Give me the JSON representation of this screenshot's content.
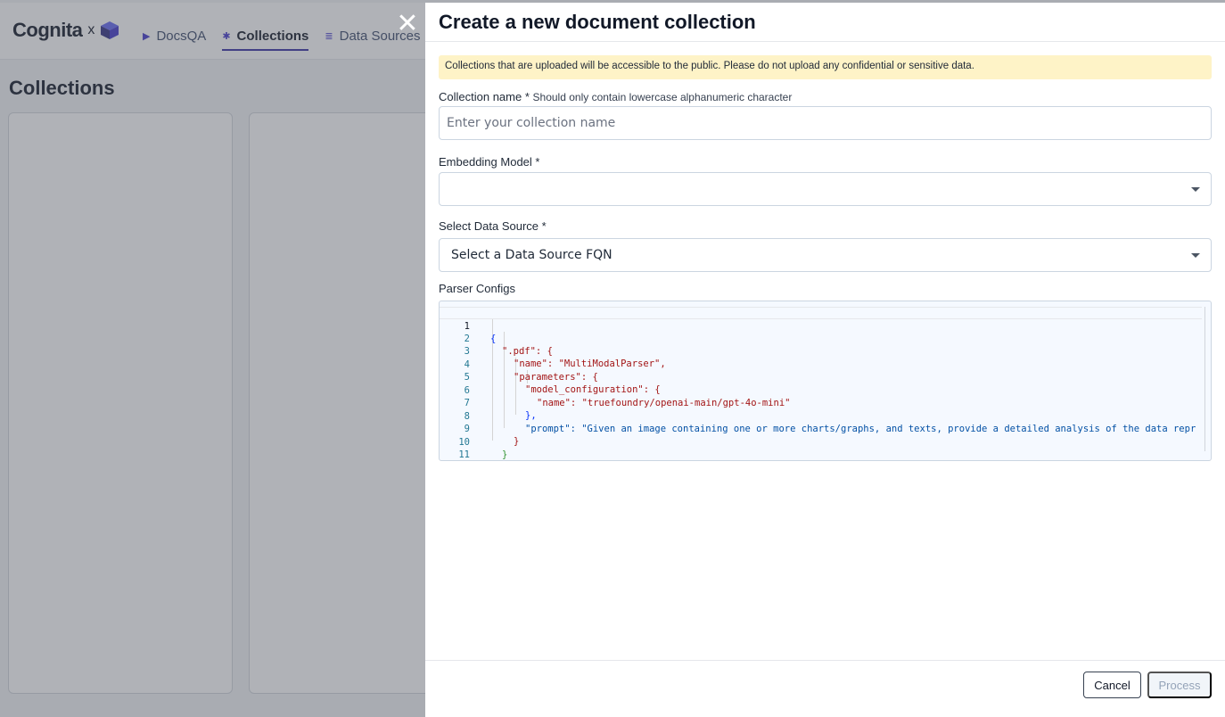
{
  "app": {
    "logo_text": "Cognita",
    "logo_x": "x",
    "nav": [
      {
        "label": "DocsQA",
        "icon": "play-icon"
      },
      {
        "label": "Collections",
        "icon": "gear-icon"
      },
      {
        "label": "Data Sources",
        "icon": "database-icon"
      }
    ],
    "page_title": "Collections"
  },
  "drawer": {
    "title": "Create a new document collection",
    "notice": "Collections that are uploaded will be accessible to the public. Please do not upload any confidential or sensitive data.",
    "collection_name": {
      "label": "Collection name *",
      "hint": "Should only contain lowercase alphanumeric character",
      "placeholder": "Enter your collection name",
      "value": ""
    },
    "embedding_model": {
      "label": "Embedding Model *",
      "value": ""
    },
    "data_source": {
      "label": "Select Data Source *",
      "value": "Select a Data Source FQN"
    },
    "parser_configs": {
      "label": "Parser Configs",
      "line_numbers": [
        "1",
        "2",
        "3",
        "4",
        "5",
        "6",
        "7",
        "8",
        "9",
        "10",
        "11"
      ],
      "code": [
        "{",
        "\".pdf\": {",
        "\"name\": \"MultiModalParser\",",
        "\"parameters\": {",
        "\"model_configuration\": {",
        "\"name\": \"truefoundry/openai-main/gpt-4o-mini\"",
        "},",
        "\"prompt\": \"Given an image containing one or more charts/graphs, and texts, provide a detailed analysis of the data repr",
        "}",
        "}",
        "}"
      ]
    },
    "footer": {
      "cancel_label": "Cancel",
      "process_label": "Process"
    }
  },
  "colors": {
    "accent": "#3730a3",
    "notice_bg": "#fef3c7",
    "editor_bg": "#f5f9ff"
  }
}
